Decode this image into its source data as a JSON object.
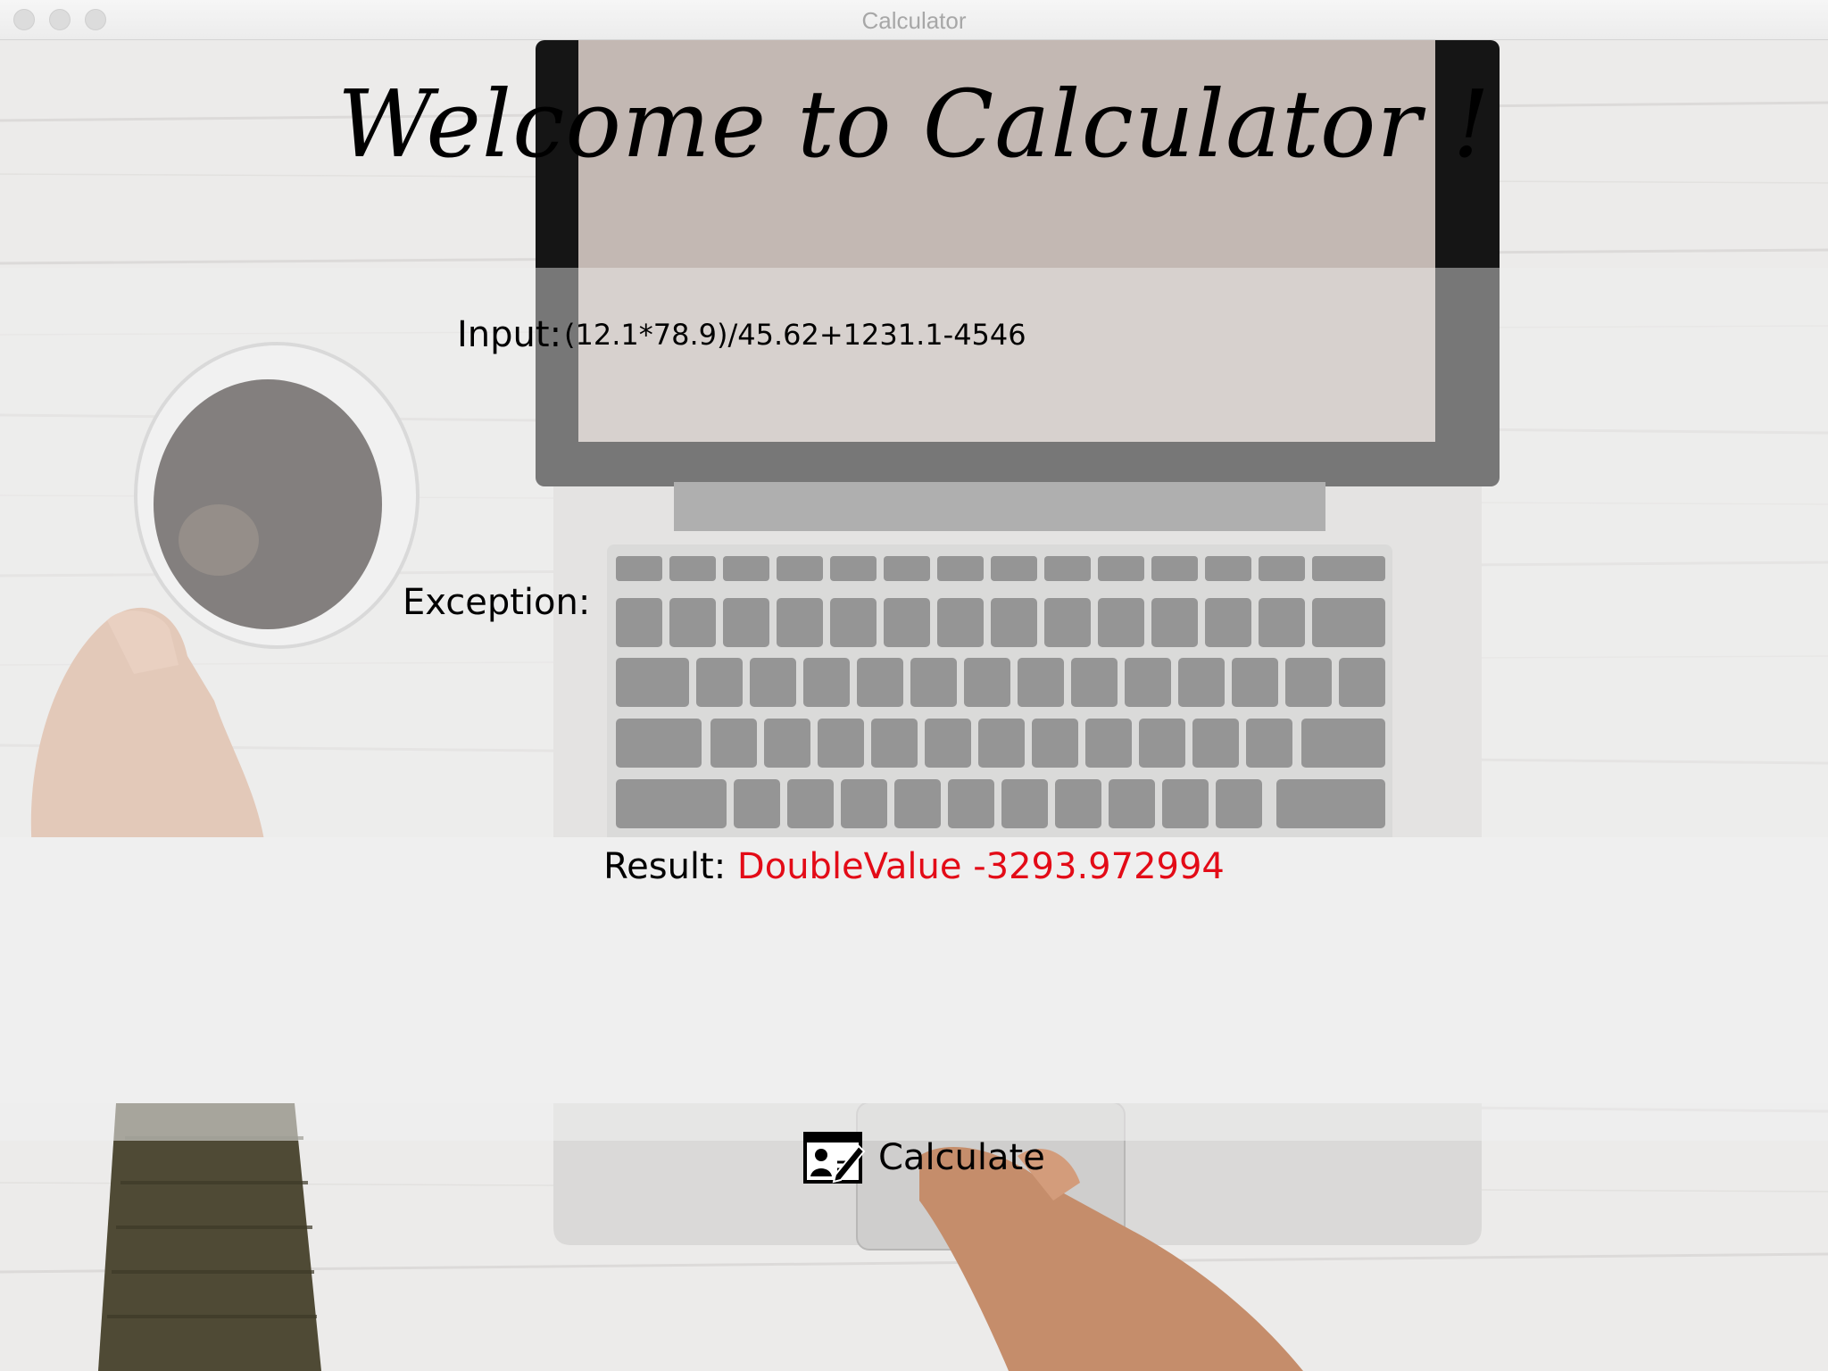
{
  "window": {
    "title": "Calculator"
  },
  "heading": "Welcome to Calculator !",
  "input": {
    "label": "Input:",
    "value": "(12.1*78.9)/45.62+1231.1-4546"
  },
  "exception": {
    "label": "Exception:",
    "value": ""
  },
  "result": {
    "label": "Result:",
    "value": "DoubleValue -3293.972994",
    "value_color": "#e30b17"
  },
  "calculate_button": {
    "label": "Calculate",
    "icon": "edit-form-icon"
  }
}
